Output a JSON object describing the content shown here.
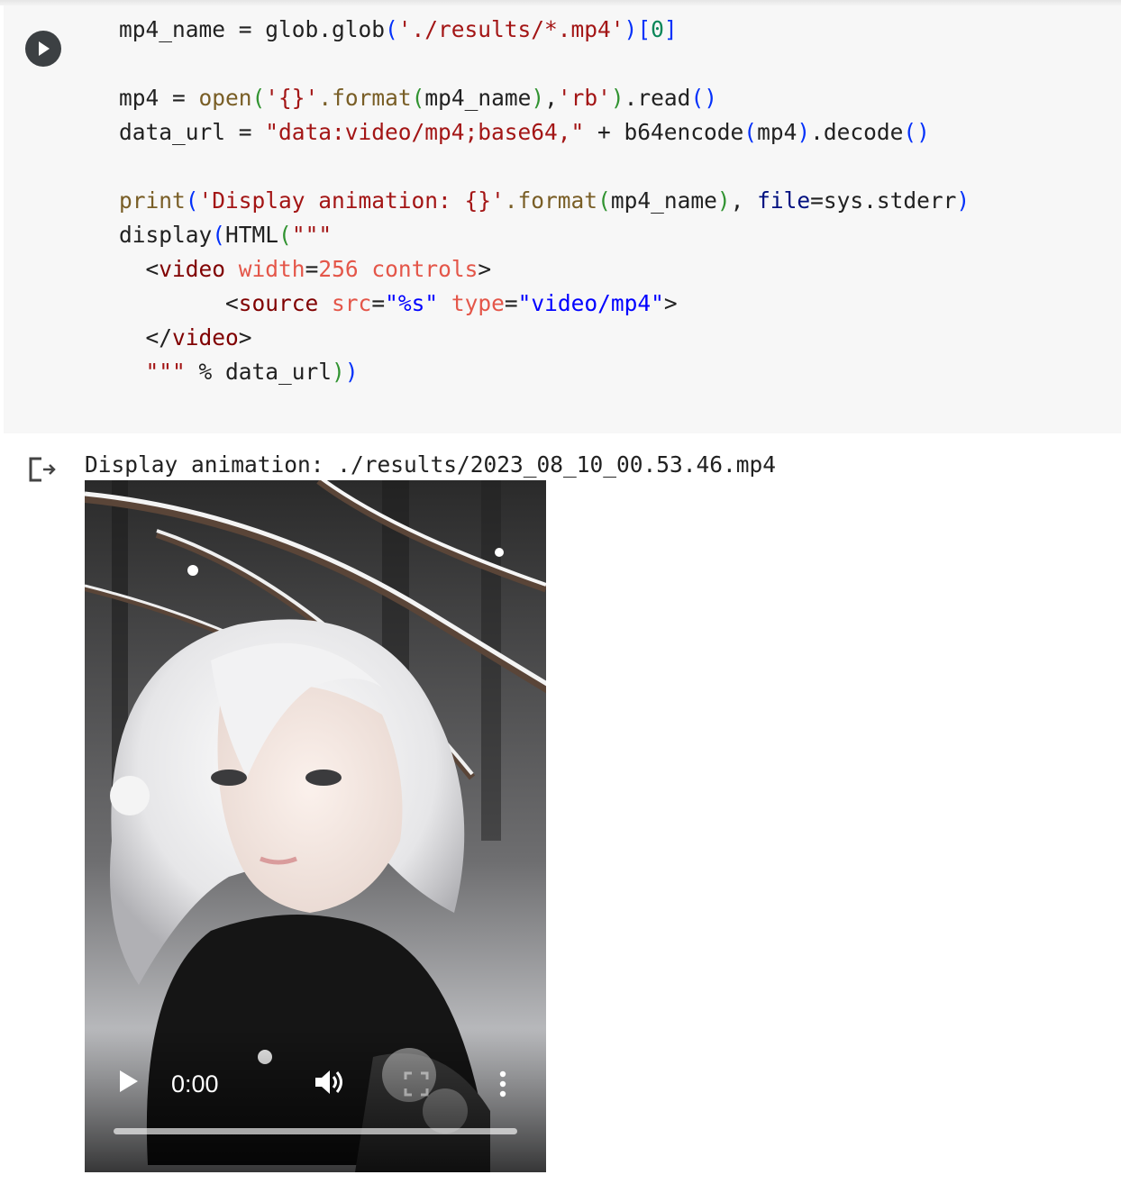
{
  "cell": {
    "code_lines": [
      [
        {
          "t": "mp4_name = glob.glob"
        },
        {
          "t": "(",
          "c": "p1"
        },
        {
          "t": "'./results/*.mp4'",
          "c": "str"
        },
        {
          "t": ")",
          "c": "p1"
        },
        {
          "t": "[",
          "c": "p1"
        },
        {
          "t": "0",
          "c": "num"
        },
        {
          "t": "]",
          "c": "p1"
        }
      ],
      [],
      [
        {
          "t": "mp4 = "
        },
        {
          "t": "open",
          "c": "fn"
        },
        {
          "t": "(",
          "c": "p2"
        },
        {
          "t": "'{}'",
          "c": "str"
        },
        {
          "t": ".format",
          "c": "fn"
        },
        {
          "t": "(",
          "c": "p2"
        },
        {
          "t": "mp4_name"
        },
        {
          "t": ")",
          "c": "p2"
        },
        {
          "t": ","
        },
        {
          "t": "'rb'",
          "c": "str"
        },
        {
          "t": ")",
          "c": "p2"
        },
        {
          "t": ".read"
        },
        {
          "t": "()",
          "c": "p1"
        }
      ],
      [
        {
          "t": "data_url = "
        },
        {
          "t": "\"data:video/mp4;base64,\"",
          "c": "str"
        },
        {
          "t": " + b64encode"
        },
        {
          "t": "(",
          "c": "p1"
        },
        {
          "t": "mp4"
        },
        {
          "t": ")",
          "c": "p1"
        },
        {
          "t": ".decode"
        },
        {
          "t": "()",
          "c": "p1"
        }
      ],
      [],
      [
        {
          "t": "print",
          "c": "fn"
        },
        {
          "t": "(",
          "c": "p1"
        },
        {
          "t": "'Display animation: {}'",
          "c": "str"
        },
        {
          "t": ".format",
          "c": "fn"
        },
        {
          "t": "(",
          "c": "p2"
        },
        {
          "t": "mp4_name"
        },
        {
          "t": ")",
          "c": "p2"
        },
        {
          "t": ", "
        },
        {
          "t": "file",
          "c": "kw"
        },
        {
          "t": "=sys.stderr"
        },
        {
          "t": ")",
          "c": "p1"
        }
      ],
      [
        {
          "t": "display"
        },
        {
          "t": "(",
          "c": "p1"
        },
        {
          "t": "HTML"
        },
        {
          "t": "(",
          "c": "p2"
        },
        {
          "t": "\"\"\"",
          "c": "str"
        }
      ],
      [
        {
          "t": "  <"
        },
        {
          "t": "video",
          "c": "tag"
        },
        {
          "t": " "
        },
        {
          "t": "width",
          "c": "att"
        },
        {
          "t": "="
        },
        {
          "t": "256",
          "c": "att"
        },
        {
          "t": " "
        },
        {
          "t": "controls",
          "c": "att"
        },
        {
          "t": ">"
        }
      ],
      [
        {
          "t": "        <"
        },
        {
          "t": "source",
          "c": "tag"
        },
        {
          "t": " "
        },
        {
          "t": "src",
          "c": "att"
        },
        {
          "t": "="
        },
        {
          "t": "\"%s\"",
          "c": "blu"
        },
        {
          "t": " "
        },
        {
          "t": "type",
          "c": "att"
        },
        {
          "t": "="
        },
        {
          "t": "\"video/mp4\"",
          "c": "blu"
        },
        {
          "t": ">"
        }
      ],
      [
        {
          "t": "  </"
        },
        {
          "t": "video",
          "c": "tag"
        },
        {
          "t": ">"
        }
      ],
      [
        {
          "t": "  "
        },
        {
          "t": "\"\"\"",
          "c": "str"
        },
        {
          "t": " % data_url"
        },
        {
          "t": ")",
          "c": "p2"
        },
        {
          "t": ")",
          "c": "p1"
        }
      ]
    ]
  },
  "output": {
    "text": "Display animation: ./results/2023_08_10_00.53.46.mp4",
    "video": {
      "time": "0:00",
      "progress": 0
    }
  },
  "icons": {
    "run": "play-circle-icon",
    "output": "output-redirect-icon",
    "play": "play-icon",
    "volume": "volume-icon",
    "fullscreen": "fullscreen-icon",
    "more": "more-vert-icon"
  }
}
